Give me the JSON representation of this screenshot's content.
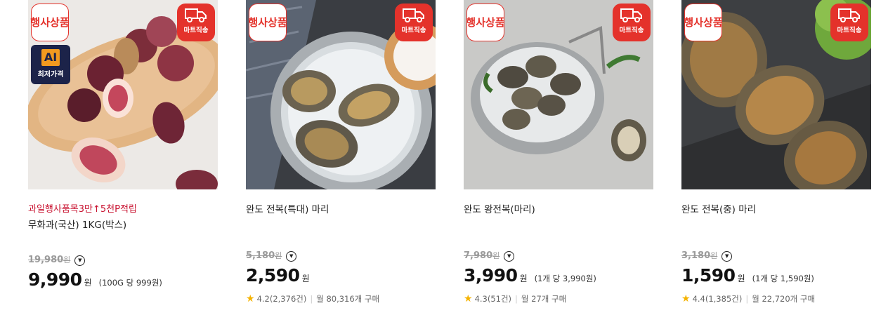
{
  "products": [
    {
      "badge_event": "행사상품",
      "badge_delivery": "마트직송",
      "badge_ai": {
        "logo": "AI",
        "text": "최저가격"
      },
      "promo": "과일행사품목3만↑5천P적립",
      "name": "무화과(국산) 1KG(박스)",
      "original_price": "19,980",
      "original_won": "원",
      "price": "9,990",
      "won": "원",
      "unit_price": "(100G 당 999원)",
      "rating": "",
      "purchases": ""
    },
    {
      "badge_event": "행사상품",
      "badge_delivery": "마트직송",
      "promo": "",
      "name": "완도 전복(특대) 마리",
      "original_price": "5,180",
      "original_won": "원",
      "price": "2,590",
      "won": "원",
      "unit_price": "",
      "rating": "4.2(2,376건)",
      "purchases": "월 80,316개 구매"
    },
    {
      "badge_event": "행사상품",
      "badge_delivery": "마트직송",
      "promo": "",
      "name": "완도 왕전복(마리)",
      "original_price": "7,980",
      "original_won": "원",
      "price": "3,990",
      "won": "원",
      "unit_price": "(1개 당 3,990원)",
      "rating": "4.3(51건)",
      "purchases": "월 27개 구매"
    },
    {
      "badge_event": "행사상품",
      "badge_delivery": "마트직송",
      "promo": "",
      "name": "완도 전복(중) 마리",
      "original_price": "3,180",
      "original_won": "원",
      "price": "1,590",
      "won": "원",
      "unit_price": "(1개 당 1,590원)",
      "rating": "4.4(1,385건)",
      "purchases": "월 22,720개 구매"
    }
  ],
  "colors": {
    "accent": "#e4322b",
    "promo": "#c8102e",
    "star": "#f5b301",
    "ai_badge_bg": "#1c2349",
    "ai_badge_logo": "#f29a1f"
  },
  "icons": {
    "delivery": "delivery-truck-icon",
    "info": "chevron-down-circle-icon",
    "rating": "star-icon"
  }
}
